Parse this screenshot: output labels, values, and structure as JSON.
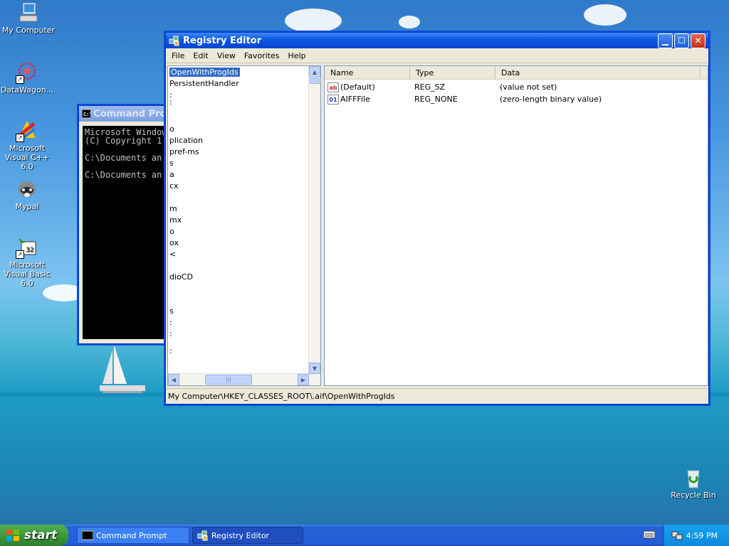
{
  "desktop": {
    "icons": [
      {
        "label": "My Computer"
      },
      {
        "label": "DataWagon..."
      },
      {
        "label": "Microsoft Visual C++ 6.0"
      },
      {
        "label": "Mypal"
      },
      {
        "label": "Microsoft Visual Basic 6.0"
      },
      {
        "label": "Recycle Bin"
      }
    ]
  },
  "cmd": {
    "title": "Command Prompt",
    "output": "Microsoft Windows\n(C) Copyright 1\n\nC:\\Documents an\n\nC:\\Documents an"
  },
  "regedit": {
    "title": "Registry Editor",
    "menu": [
      "File",
      "Edit",
      "View",
      "Favorites",
      "Help"
    ],
    "tree": [
      {
        "label": "OpenWithProgIds",
        "selected": true
      },
      {
        "label": "PersistentHandler"
      },
      {
        "label": ":"
      },
      {
        "label": ":"
      },
      {
        "label": "o"
      },
      {
        "label": "plication"
      },
      {
        "label": "pref-ms"
      },
      {
        "label": "s"
      },
      {
        "label": "a"
      },
      {
        "label": "cx"
      },
      {
        "label": "m"
      },
      {
        "label": "mx"
      },
      {
        "label": "o"
      },
      {
        "label": "ox"
      },
      {
        "label": "<"
      },
      {
        "label": "dioCD"
      },
      {
        "label": "s"
      },
      {
        "label": ":"
      },
      {
        "label": ":"
      },
      {
        "label": ":"
      }
    ],
    "columns": [
      "Name",
      "Type",
      "Data"
    ],
    "values": [
      {
        "name": "(Default)",
        "type": "REG_SZ",
        "data": "(value not set)",
        "icon": "string-value-icon"
      },
      {
        "name": "AIFFFile",
        "type": "REG_NONE",
        "data": "(zero-length binary value)",
        "icon": "binary-value-icon"
      }
    ],
    "status": "My Computer\\HKEY_CLASSES_ROOT\\.aif\\OpenWithProgIds"
  },
  "taskbar": {
    "start_label": "start",
    "buttons": [
      "Command Prompt",
      "Registry Editor"
    ],
    "clock": "4:59 PM"
  },
  "colors": {
    "title_active": "#0645d1",
    "selection": "#316ac5",
    "start_green": "#3c9a3c"
  }
}
